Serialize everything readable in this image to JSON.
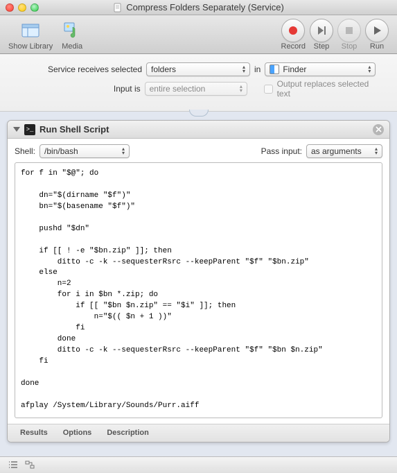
{
  "window": {
    "title": "Compress Folders Separately (Service)"
  },
  "toolbar": {
    "show_library": "Show Library",
    "media": "Media",
    "record": "Record",
    "step": "Step",
    "stop": "Stop",
    "run": "Run"
  },
  "config": {
    "receives_label": "Service receives selected",
    "receives_value": "folders",
    "in_label": "in",
    "in_value": "Finder",
    "input_is_label": "Input is",
    "input_is_value": "entire selection",
    "output_replaces_label": "Output replaces selected text"
  },
  "action": {
    "title": "Run Shell Script",
    "shell_label": "Shell:",
    "shell_value": "/bin/bash",
    "pass_input_label": "Pass input:",
    "pass_input_value": "as arguments",
    "script": "for f in \"$@\"; do\n\n    dn=\"$(dirname \"$f\")\"\n    bn=\"$(basename \"$f\")\"\n\n    pushd \"$dn\"\n\n    if [[ ! -e \"$bn.zip\" ]]; then\n        ditto -c -k --sequesterRsrc --keepParent \"$f\" \"$bn.zip\"\n    else\n        n=2\n        for i in $bn *.zip; do\n            if [[ \"$bn $n.zip\" == \"$i\" ]]; then\n                n=\"$(( $n + 1 ))\"\n            fi\n        done\n        ditto -c -k --sequesterRsrc --keepParent \"$f\" \"$bn $n.zip\"\n    fi\n\ndone\n\nafplay /System/Library/Sounds/Purr.aiff",
    "footer_results": "Results",
    "footer_options": "Options",
    "footer_description": "Description"
  }
}
